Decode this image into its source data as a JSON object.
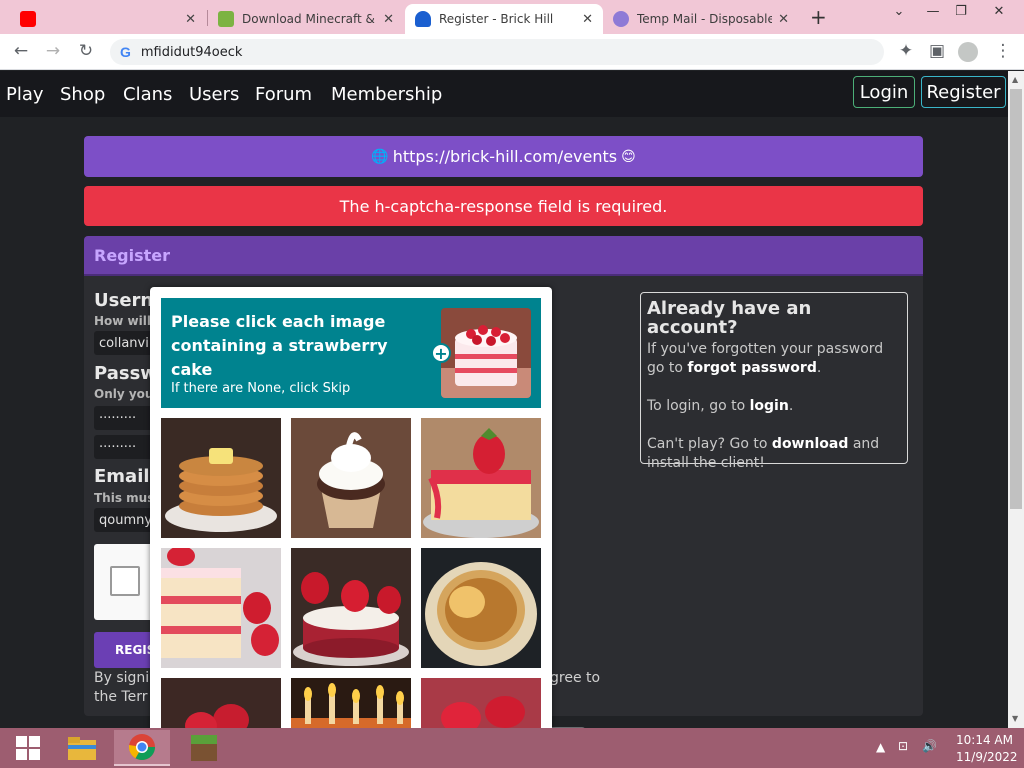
{
  "browser": {
    "tabs": [
      {
        "title": "",
        "favicon_color": "#ff0000",
        "icon": "youtube-icon"
      },
      {
        "title": "Download Minecraft & S",
        "favicon_color": "#7cb342",
        "icon": "minecraft-icon"
      },
      {
        "title": "Register - Brick Hill",
        "favicon_color": "#1a5fd0",
        "icon": "brickhill-icon",
        "active": true
      },
      {
        "title": "Temp Mail - Disposable T",
        "favicon_color": "#8e7ad6",
        "icon": "tempmail-icon"
      }
    ],
    "new_tab": "+",
    "window_controls": {
      "minimize": "—",
      "restore": "❐",
      "close": "✕"
    },
    "address": "mfididut94oeck"
  },
  "nav": {
    "links": [
      "Play",
      "Shop",
      "Clans",
      "Users",
      "Forum",
      "Membership"
    ],
    "login": "Login",
    "register": "Register"
  },
  "alerts": {
    "events_url": "https://brick-hill.com/events",
    "error": "The h-captcha-response field is required."
  },
  "register_form": {
    "title": "Register",
    "username_label": "Usern",
    "username_hint": "How will",
    "username_value": "collanvi",
    "password_label": "Passw",
    "password_hint": "Only you",
    "password_value": "·········",
    "confirm_value": "·········",
    "email_label": "Email",
    "email_hint": "This mus",
    "email_value": "qoumny",
    "submit_label": "REGIS",
    "terms_left_1": "By signi",
    "terms_left_2": "the Terr",
    "terms_right": "gree to"
  },
  "side_box": {
    "title": "Already have an account?",
    "line1": "If you've forgotten your password",
    "line2_prefix": "go to",
    "line2_link": "forgot password",
    "line2_suffix": ".",
    "line3_prefix": "To login, go to",
    "line3_link": "login",
    "line3_suffix": ".",
    "line4_prefix": "Can't play? Go to",
    "line4_link": "download",
    "line4_suffix": "and",
    "line5": "install the client!"
  },
  "captcha": {
    "prompt": "Please click each image containing a strawberry cake",
    "skip_hint": "If there are None, click Skip",
    "plus": "+",
    "tiles": [
      "pancakes",
      "cupcake",
      "strawberry-cake-slice",
      "strawberry-layer-cake",
      "strawberry-round-cake",
      "pancake-plate",
      "strawberry-cake-partial",
      "birthday-candles-cake",
      "strawberries-partial"
    ]
  },
  "taskbar": {
    "apps": [
      "windows-start",
      "file-explorer",
      "chrome",
      "minecraft"
    ],
    "time": "10:14 AM",
    "date": "11/9/2022"
  },
  "colors": {
    "purple_alert": "#7d4fc7",
    "red_alert": "#ea3547",
    "card_header": "#6a40a8",
    "captcha_teal": "#00838f"
  }
}
